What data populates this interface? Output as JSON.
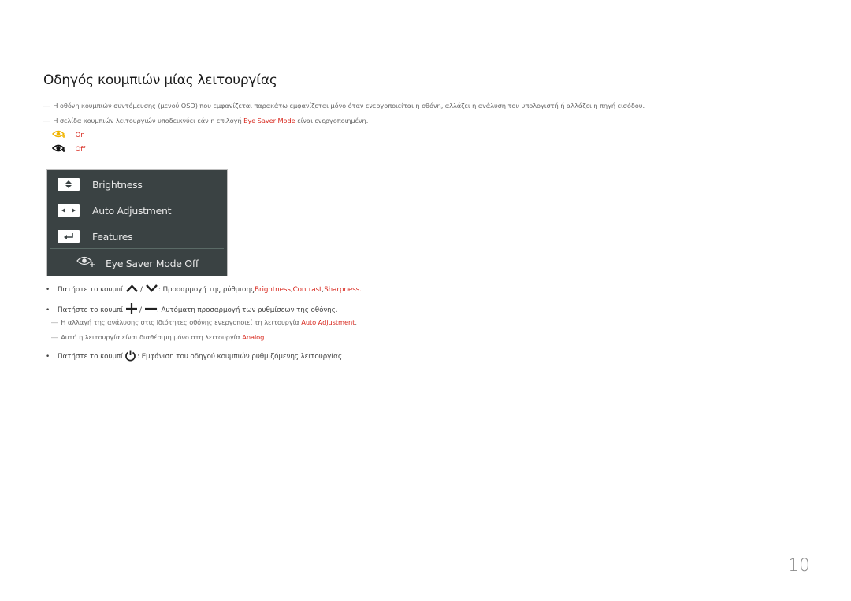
{
  "page": {
    "title": "Οδηγός κουμπιών μίας λειτουργίας",
    "page_number": "10",
    "accent_color": "#d8281e"
  },
  "notes": [
    {
      "dash": "―",
      "text": "Η οθόνη κουμπιών συντόμευσης (μενού OSD) που εμφανίζεται παρακάτω εμφανίζεται μόνο όταν ενεργοποιείται η οθόνη, αλλάζει η ανάλυση του υπολογιστή ή αλλάζει η πηγή εισόδου."
    },
    {
      "dash": "―",
      "text_before": "Η σελίδα κουμπιών λειτουργιών υποδεικνύει εάν η επιλογή ",
      "highlight": "Eye Saver Mode",
      "text_after": " είναι ενεργοποιημένη."
    }
  ],
  "legend": [
    {
      "icon": "eye-saver-on-icon",
      "label": ": On",
      "color": "#f0b400"
    },
    {
      "icon": "eye-saver-off-icon",
      "label": ": Off",
      "color": "#111111"
    }
  ],
  "osd": {
    "items": [
      {
        "icon": "up-down-arrows-icon",
        "label": "Brightness"
      },
      {
        "icon": "left-right-arrows-icon",
        "label": "Auto Adjustment"
      },
      {
        "icon": "enter-return-icon",
        "label": "Features"
      }
    ],
    "eye_saver": {
      "icon": "eye-saver-icon",
      "label": "Eye Saver Mode Off"
    }
  },
  "bullets": [
    {
      "prefix": "Πατήστε το κουμπί",
      "sep": "/",
      "suffix": ": Προσαρμογή της ρύθμισης ",
      "h1": "Brightness",
      "c1": ", ",
      "h2": "Contrast",
      "c2": ", ",
      "h3": "Sharpness",
      "end": "."
    },
    {
      "prefix": "Πατήστε το κουμπί",
      "sep": "/",
      "suffix": " : Αυτόματη προσαρμογή των ρυθμίσεων της οθόνης."
    },
    {
      "prefix": "Πατήστε το κουμπί",
      "suffix": ": Εμφάνιση του οδηγού κουμπιών ρυθμιζόμενης λειτουργίας"
    }
  ],
  "subnotes": [
    {
      "dash": "―",
      "text_before": "Η αλλαγή της ανάλυσης στις Ιδιότητες οθόνης ενεργοποιεί τη λειτουργία ",
      "highlight": "Auto Adjustment",
      "text_after": "."
    },
    {
      "dash": "―",
      "text_before": "Αυτή η λειτουργία είναι διαθέσιμη μόνο στη λειτουργία ",
      "highlight": "Analog",
      "text_after": "."
    }
  ]
}
